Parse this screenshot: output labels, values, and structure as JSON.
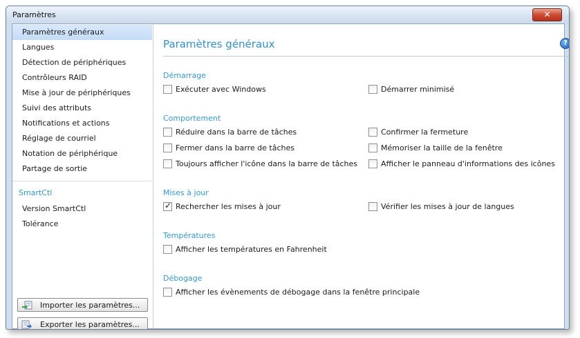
{
  "window": {
    "title": "Paramètres",
    "close_label": "✕"
  },
  "sidebar": {
    "items": [
      {
        "label": "Paramètres généraux",
        "selected": true
      },
      {
        "label": "Langues"
      },
      {
        "label": "Détection de périphériques"
      },
      {
        "label": "Contrôleurs RAID"
      },
      {
        "label": "Mise à jour de périphériques"
      },
      {
        "label": "Suivi des attributs"
      },
      {
        "label": "Notifications et actions"
      },
      {
        "label": "Réglage de courriel"
      },
      {
        "label": "Notation de périphérique"
      },
      {
        "label": "Partage de sortie"
      }
    ],
    "group_label": "SmartCtl",
    "group_items": [
      {
        "label": "Version SmartCtl"
      },
      {
        "label": "Tolérance"
      }
    ],
    "import_button": "Importer les paramètres...",
    "export_button": "Exporter les paramètres..."
  },
  "main": {
    "title": "Paramètres généraux",
    "help_glyph": "?",
    "sections": {
      "startup": {
        "label": "Démarrage",
        "run_with_windows": {
          "label": "Exécuter avec Windows",
          "checked": false
        },
        "start_minimized": {
          "label": "Démarrer minimisé",
          "checked": false
        }
      },
      "behavior": {
        "label": "Comportement",
        "minimize_to_tray": {
          "label": "Réduire dans la barre de tâches",
          "checked": false
        },
        "close_to_tray": {
          "label": "Fermer dans la barre de tâches",
          "checked": false
        },
        "always_tray_icon": {
          "label": "Toujours afficher l'icône dans la barre de tâches",
          "checked": false
        },
        "confirm_close": {
          "label": "Confirmer la fermeture",
          "checked": false
        },
        "remember_size": {
          "label": "Mémoriser la taille de la fenêtre",
          "checked": false
        },
        "icon_info_panel": {
          "label": "Afficher le panneau d'informations des icônes",
          "checked": false
        }
      },
      "updates": {
        "label": "Mises à jour",
        "check_updates": {
          "label": "Rechercher les mises à jour",
          "checked": true
        },
        "check_language_updates": {
          "label": "Vérifier les mises à jour de langues",
          "checked": false
        }
      },
      "temperatures": {
        "label": "Températures",
        "fahrenheit": {
          "label": "Afficher les températures en Fahrenheit",
          "checked": false
        }
      },
      "debug": {
        "label": "Débogage",
        "show_debug_events": {
          "label": "Afficher les évènements de débogage dans la fenêtre principale",
          "checked": false
        }
      }
    }
  },
  "colors": {
    "accent": "#2f9ad9",
    "selection": "#c4dcf6",
    "close": "#cf4a31"
  }
}
